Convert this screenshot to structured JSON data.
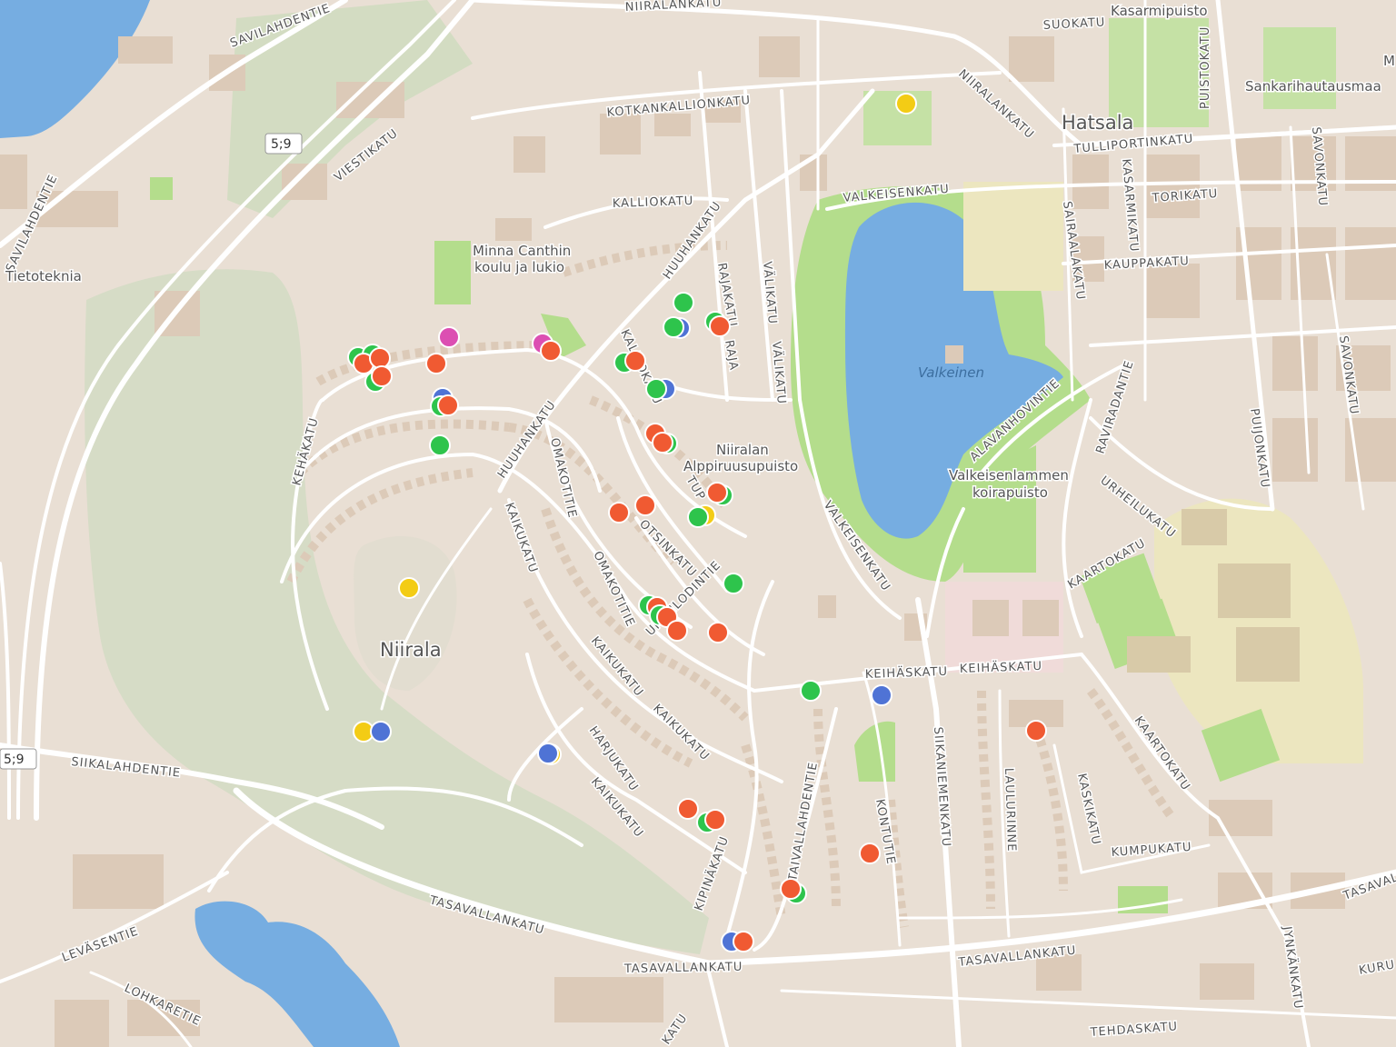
{
  "map": {
    "colors": {
      "land": "#e9dfd4",
      "park": "#c8dcae",
      "park_bright": "#b4dd8c",
      "water": "#76ade1",
      "campus": "#ece6bf",
      "road": "#ffffff",
      "building": "#dccab8",
      "marker_red": "#f05a32",
      "marker_green": "#2ec44c",
      "marker_blue": "#4f73d5",
      "marker_yellow": "#f3cc15",
      "marker_pink": "#dc4fb2"
    },
    "places": {
      "niirala": "Niirala",
      "hatsala": "Hatsala",
      "kasarmipuisto": "Kasarmipuisto",
      "sankarihautausmaa": "Sankarihautausmaa",
      "minna_canthin_1": "Minna Canthin",
      "minna_canthin_2": "koulu ja lukio",
      "alppiruusupuisto_1": "Niiralan",
      "alppiruusupuisto_2": "Alppiruusupuisto",
      "koirapuisto_1": "Valkeisenlammen",
      "koirapuisto_2": "koirapuisto",
      "tietoteknia": "Tietoteknia",
      "valkeinen": "Valkeinen",
      "partial_m": "M"
    },
    "road_shields": [
      "5;9",
      "5;9"
    ],
    "streets": {
      "savilahdentie_top": "SAVILAHDENTIE",
      "savilahdentie_left": "SAVILAHDENTIE",
      "niiralankatu_top": "NIIRALANKATU",
      "niiralankatu_right": "NIIRALANKATU",
      "suokatu": "SUOKATU",
      "puistokatu": "PUISTOKATU",
      "kotkankallionkatu": "KOTKANKALLIONKATU",
      "viestikatu": "VIESTIKATU",
      "kalliokatu": "KALLIOKATU",
      "huuhankatu_1": "HUUHANKATU",
      "huuhankatu_2": "HUUHANKATU",
      "rajakatu": "RAJAKATU",
      "valikatu_1": "VÄLIKATU",
      "valikatu_2": "VÄLIKATU",
      "valkeisenkatu_1": "VALKEISENKATU",
      "valkeisenkatu_2": "VALKEISENKATU",
      "tulliportinkatu": "TULLIPORTINKATU",
      "kasarmikatu": "KASARMIKATU",
      "torikatu": "TORIKATU",
      "sairaalakatu": "SAIRAALAKATU",
      "kauppakatu": "KAUPPAKATU",
      "savonkatu_1": "SAVONKATU",
      "savonkatu_2": "SAVONKATU",
      "puijonkatu": "PUIJONKATU",
      "alavanhovintie": "ALAVANHOVINTIE",
      "raviradantie": "RAVIRADANTIE",
      "urheilukatu": "URHEILUKATU",
      "kaartokatu_1": "KAARTOKATU",
      "kaartokatu_2": "KAARTOKATU",
      "kalliokatu_short": "KALLIOKATU",
      "tuppuri": "TUP",
      "kehakatu": "KEHÄKATU",
      "omakotitie_1": "OMAKOTITIE",
      "omakotitie_2": "OMAKOTITIE",
      "otsinkatu": "OTSINKATU",
      "ukonlodintie": "UKONLODINTIE",
      "kaikukatu_1": "KAIKUKATU",
      "kaikukatu_2": "KAIKUKATU",
      "kaikukatu_3": "KAIKUKATU",
      "kaikukatu_4": "KAIKUKATU",
      "harjukatu": "HARJUKATU",
      "keihaskatu_1": "KEIHÄSKATU",
      "keihaskatu_2": "KEIHÄSKATU",
      "siikaniemenkatu": "SIIKANIEMENKATU",
      "laulurinne": "LAULURINNE",
      "kaskikatu": "KASKIKATU",
      "kumpukatu": "KUMPUKATU",
      "taivallahdentie": "TAIVALLAHDENTIE",
      "kontutie": "KONTUTIE",
      "kipinakatu": "KIPINÄKATU",
      "siikalahdentie": "SIIKALAHDENTIE",
      "levasentie": "LEVÄSENTIE",
      "lohkaretie": "LOHKARETIE",
      "tasavallankatu_1": "TASAVALLANKATU",
      "tasavallankatu_2": "TASAVALLANKATU",
      "tasavallankatu_3": "TASAVALLANKATU",
      "tasavallankatu_4": "TASAVALLANKATU",
      "tehdaskatu": "TEHDASKATU",
      "jynkankatu": "JYNKÄNKATU",
      "kuru": "KURU",
      "katu_partial": "KATU",
      "raja_partial": "RAJA"
    }
  }
}
